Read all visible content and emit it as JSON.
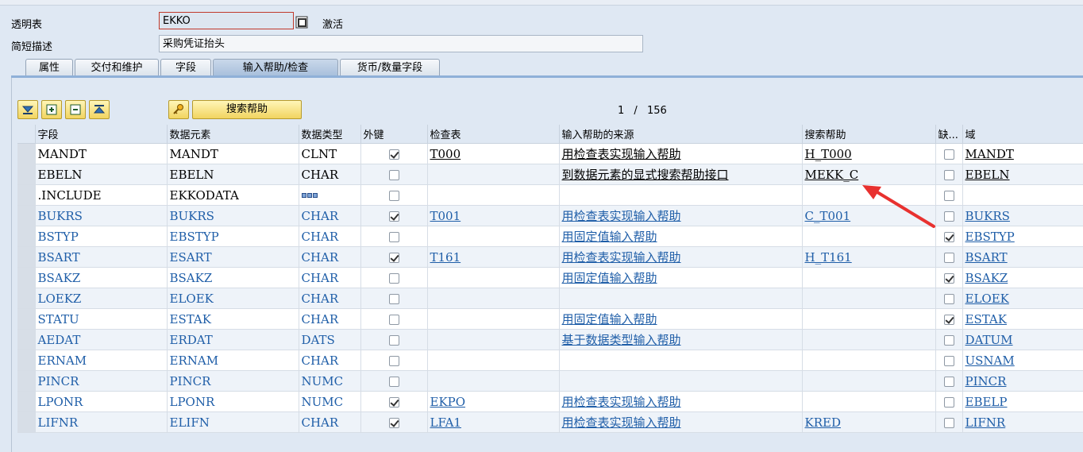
{
  "header": {
    "table_label": "透明表",
    "table_value": "EKKO",
    "status": "激活",
    "desc_label": "简短描述",
    "desc_value": "采购凭证抬头"
  },
  "tabs": [
    {
      "label": "属性"
    },
    {
      "label": "交付和维护"
    },
    {
      "label": "字段"
    },
    {
      "label": "输入帮助/检查",
      "active": true
    },
    {
      "label": "货币/数量字段"
    }
  ],
  "toolbar": {
    "search_help_label": "搜索帮助",
    "pager_current": "1",
    "pager_sep": "/",
    "pager_total": "156"
  },
  "columns": [
    "字段",
    "数据元素",
    "数据类型",
    "外键",
    "检查表",
    "输入帮助的来源",
    "搜索帮助",
    "缺...",
    "域"
  ],
  "rows": [
    {
      "field": "MANDT",
      "element": "MANDT",
      "type": "CLNT",
      "fk": true,
      "check": "T000",
      "source": "用检查表实现输入帮助",
      "search": "H_T000",
      "missing": false,
      "domain": "MANDT",
      "blue": false
    },
    {
      "field": "EBELN",
      "element": "EBELN",
      "type": "CHAR",
      "fk": false,
      "check": "",
      "source": "到数据元素的显式搜索帮助接口",
      "search": "MEKK_C",
      "missing": false,
      "domain": "EBELN",
      "blue": false
    },
    {
      "field": ".INCLUDE",
      "element": "EKKODATA",
      "type": "",
      "fk": false,
      "check": "",
      "source": "",
      "search": "",
      "missing": false,
      "domain": "",
      "blue": false,
      "struct": true
    },
    {
      "field": "BUKRS",
      "element": "BUKRS",
      "type": "CHAR",
      "fk": true,
      "check": "T001",
      "source": "用检查表实现输入帮助",
      "search": "C_T001",
      "missing": false,
      "domain": "BUKRS",
      "blue": true
    },
    {
      "field": "BSTYP",
      "element": "EBSTYP",
      "type": "CHAR",
      "fk": false,
      "check": "",
      "source": "用固定值输入帮助",
      "search": "",
      "missing": true,
      "domain": "EBSTYP",
      "blue": true
    },
    {
      "field": "BSART",
      "element": "ESART",
      "type": "CHAR",
      "fk": true,
      "check": "T161",
      "source": "用检查表实现输入帮助",
      "search": "H_T161",
      "missing": false,
      "domain": "BSART",
      "blue": true
    },
    {
      "field": "BSAKZ",
      "element": "BSAKZ",
      "type": "CHAR",
      "fk": false,
      "check": "",
      "source": "用固定值输入帮助",
      "search": "",
      "missing": true,
      "domain": "BSAKZ",
      "blue": true
    },
    {
      "field": "LOEKZ",
      "element": "ELOEK",
      "type": "CHAR",
      "fk": false,
      "check": "",
      "source": "",
      "search": "",
      "missing": false,
      "domain": "ELOEK",
      "blue": true
    },
    {
      "field": "STATU",
      "element": "ESTAK",
      "type": "CHAR",
      "fk": false,
      "check": "",
      "source": "用固定值输入帮助",
      "search": "",
      "missing": true,
      "domain": "ESTAK",
      "blue": true
    },
    {
      "field": "AEDAT",
      "element": "ERDAT",
      "type": "DATS",
      "fk": false,
      "check": "",
      "source": "基于数据类型输入帮助",
      "search": "",
      "missing": false,
      "domain": "DATUM",
      "blue": true
    },
    {
      "field": "ERNAM",
      "element": "ERNAM",
      "type": "CHAR",
      "fk": false,
      "check": "",
      "source": "",
      "search": "",
      "missing": false,
      "domain": "USNAM",
      "blue": true
    },
    {
      "field": "PINCR",
      "element": "PINCR",
      "type": "NUMC",
      "fk": false,
      "check": "",
      "source": "",
      "search": "",
      "missing": false,
      "domain": "PINCR",
      "blue": true
    },
    {
      "field": "LPONR",
      "element": "LPONR",
      "type": "NUMC",
      "fk": true,
      "check": "EKPO",
      "source": "用检查表实现输入帮助",
      "search": "",
      "missing": false,
      "domain": "EBELP",
      "blue": true
    },
    {
      "field": "LIFNR",
      "element": "ELIFN",
      "type": "CHAR",
      "fk": true,
      "check": "LFA1",
      "source": "用检查表实现输入帮助",
      "search": "KRED",
      "missing": false,
      "domain": "LIFNR",
      "blue": true
    }
  ]
}
